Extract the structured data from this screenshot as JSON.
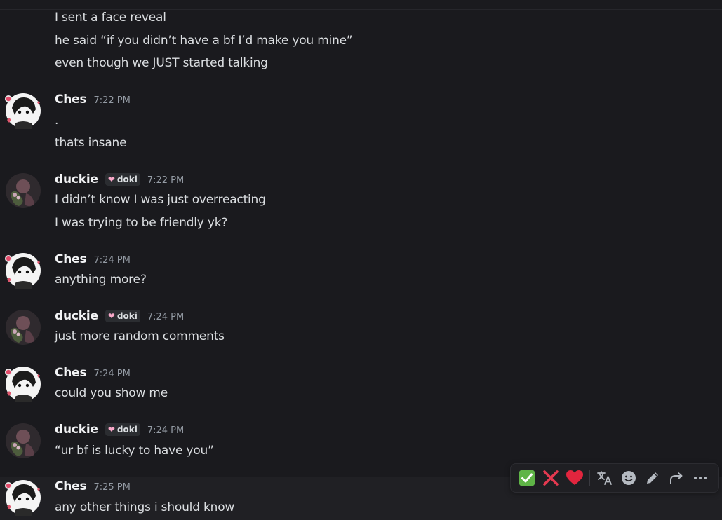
{
  "messages": {
    "top": {
      "lines": [
        "I sent a face reveal",
        "he said “if you didn’t have a bf I’d make you mine”",
        "even though we JUST started talking"
      ]
    },
    "m1": {
      "author": "Ches",
      "time": "7:22 PM",
      "lines": [
        ".",
        "thats insane"
      ]
    },
    "m2": {
      "author": "duckie",
      "tag": "doki",
      "time": "7:22 PM",
      "lines": [
        "I didn’t know I was just overreacting",
        "I was trying to be friendly yk?"
      ]
    },
    "m3": {
      "author": "Ches",
      "time": "7:24 PM",
      "lines": [
        "anything more?"
      ]
    },
    "m4": {
      "author": "duckie",
      "tag": "doki",
      "time": "7:24 PM",
      "lines": [
        "just more random comments"
      ]
    },
    "m5": {
      "author": "Ches",
      "time": "7:24 PM",
      "lines": [
        "could you show me"
      ]
    },
    "m6": {
      "author": "duckie",
      "tag": "doki",
      "time": "7:24 PM",
      "lines": [
        "“ur bf is lucky to have you”"
      ]
    },
    "m7": {
      "author": "Ches",
      "time": "7:25 PM",
      "lines": [
        "any other things i should know"
      ]
    }
  },
  "toolbar": {
    "buttons": [
      {
        "icon": "check-mark-emoji-icon",
        "glyph": "✅"
      },
      {
        "icon": "cross-mark-emoji-icon",
        "glyph": "❌"
      },
      {
        "icon": "red-heart-emoji-icon",
        "glyph": "❤"
      },
      {
        "icon": "translate-icon"
      },
      {
        "icon": "add-reaction-icon"
      },
      {
        "icon": "edit-icon"
      },
      {
        "icon": "forward-icon"
      },
      {
        "icon": "more-icon"
      }
    ]
  },
  "colors": {
    "background": "#1a1a1e",
    "text": "#dbdee1",
    "username": "#f2f3f5",
    "timestamp": "#949ba4",
    "tag_heart": "#f9a8c9"
  }
}
